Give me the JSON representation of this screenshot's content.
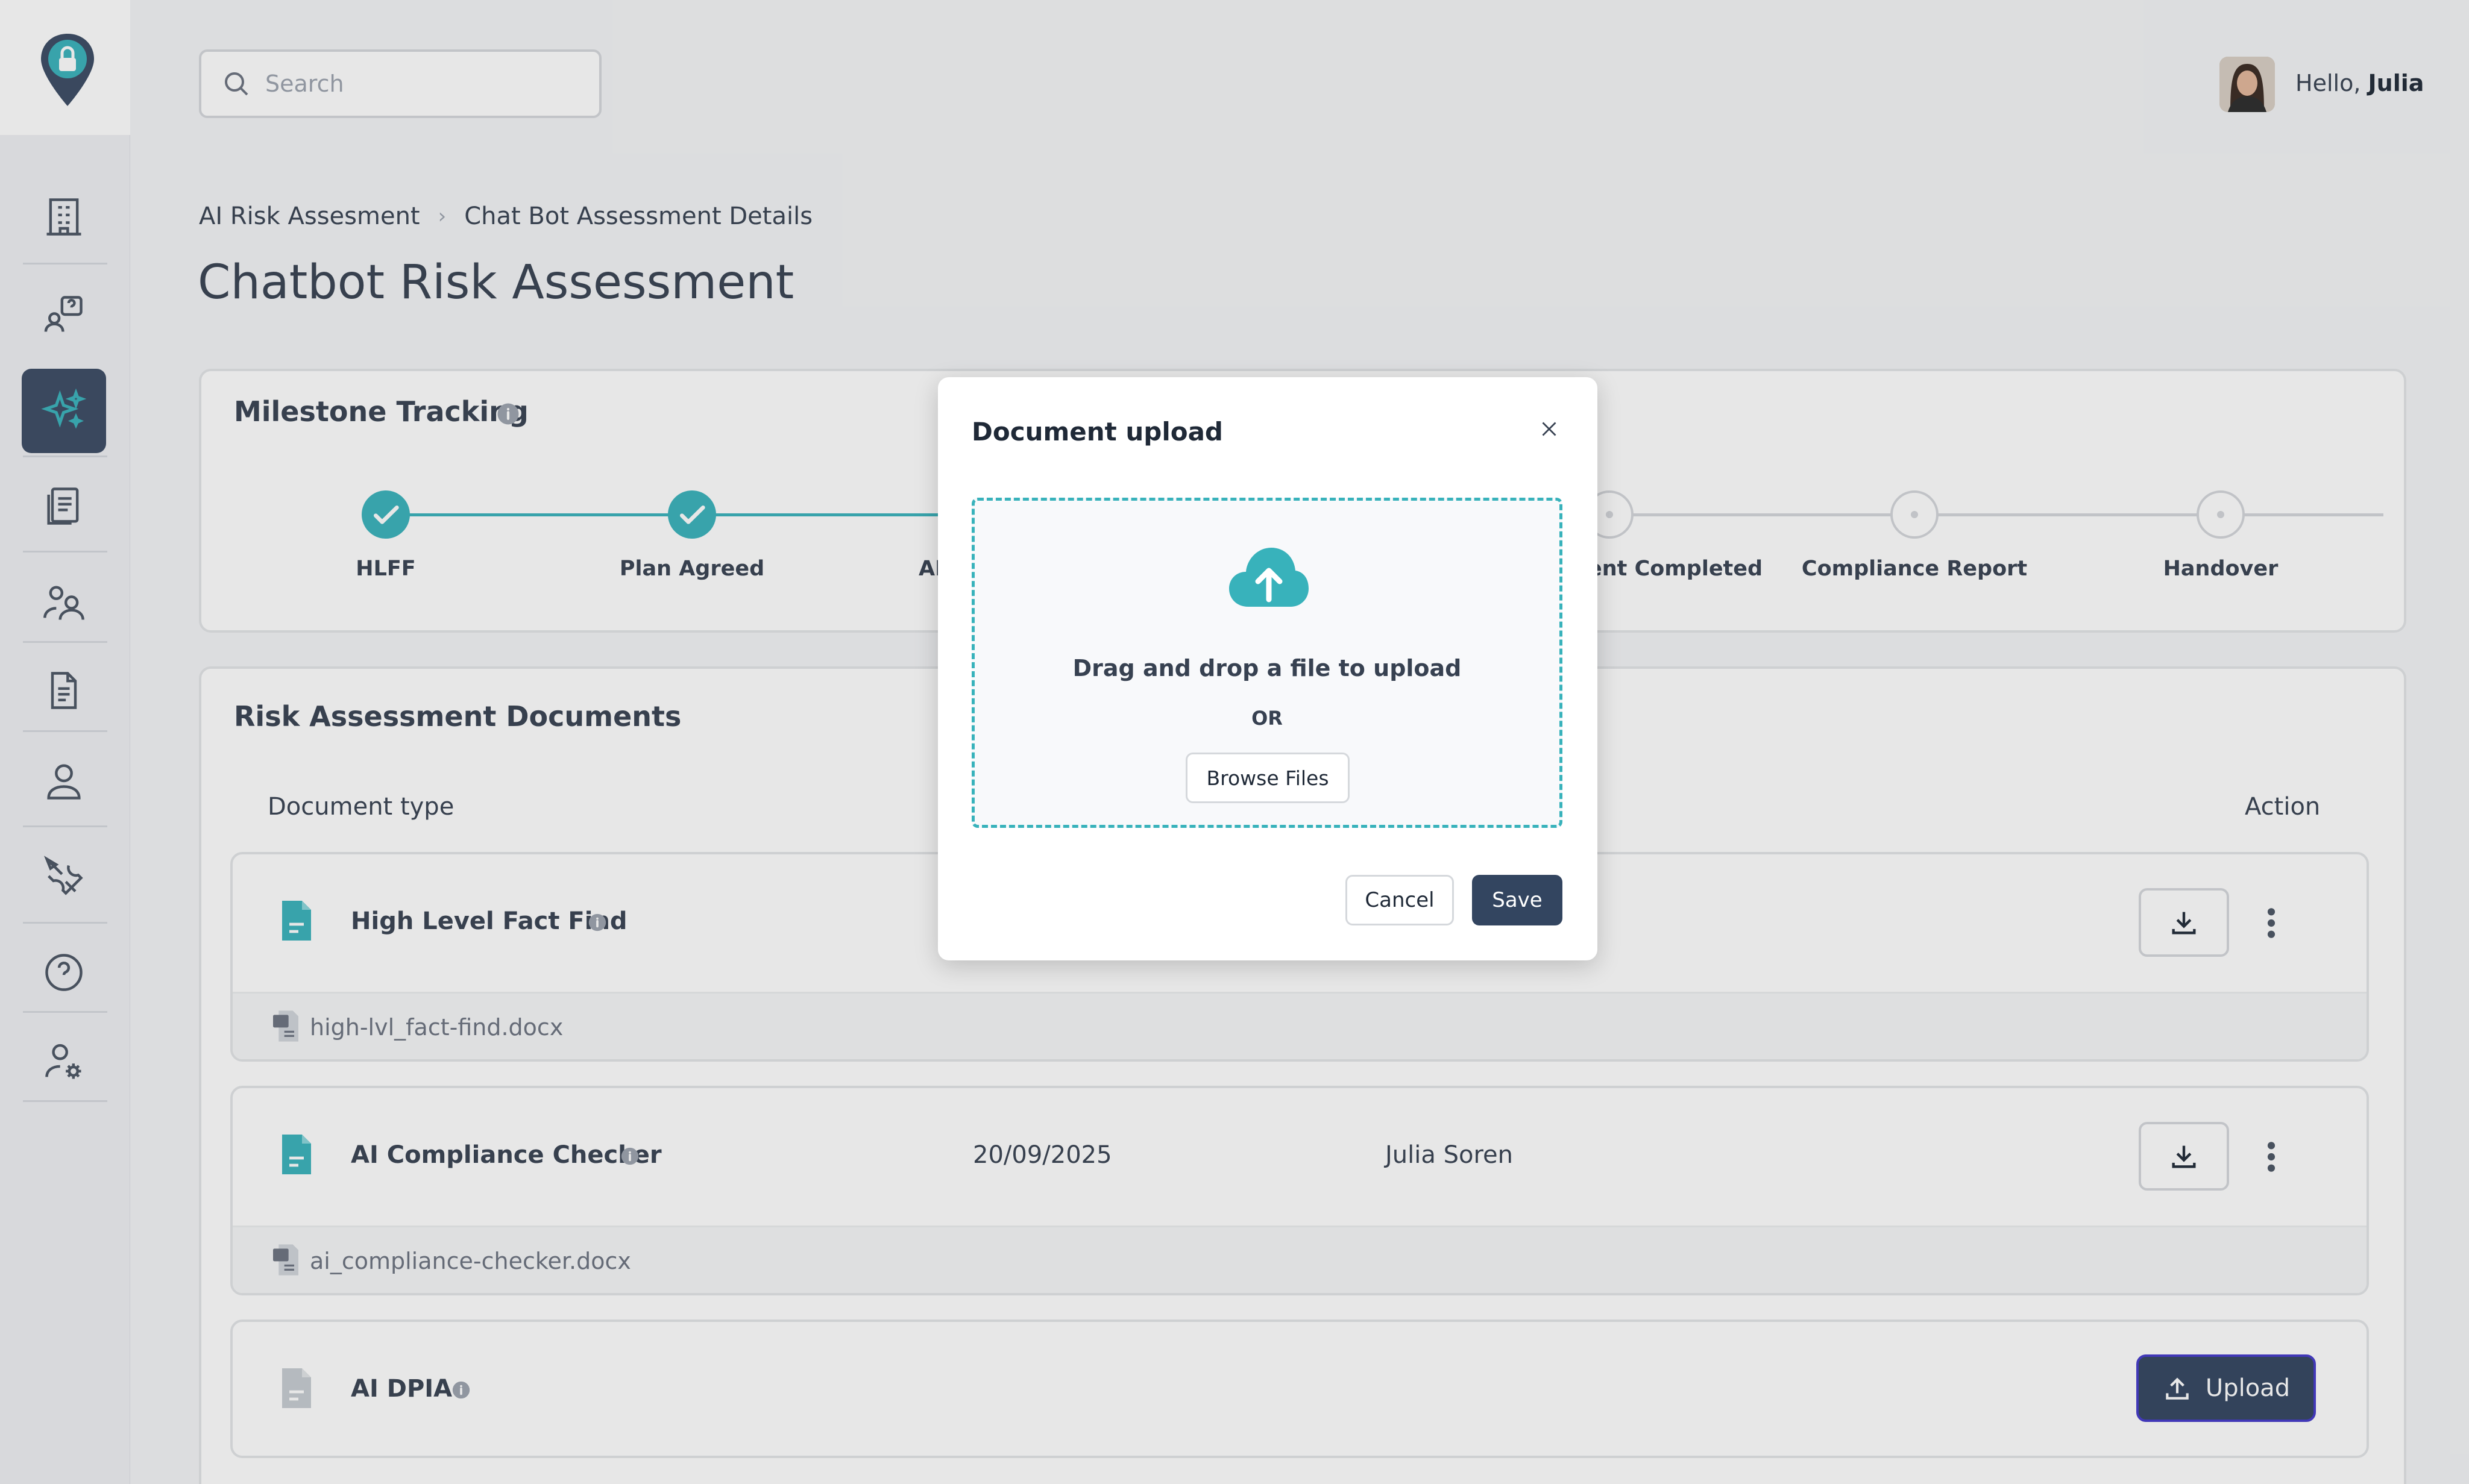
{
  "app": {
    "accent": "#38b2bb",
    "primary": "#334560"
  },
  "search": {
    "placeholder": "Search"
  },
  "user": {
    "greeting": "Hello,",
    "name": "Julia"
  },
  "breadcrumb": {
    "items": [
      "AI Risk Assesment",
      "Chat Bot Assessment Details"
    ],
    "separator": "›"
  },
  "page": {
    "title": "Chatbot Risk Assessment"
  },
  "milestones": {
    "title": "Milestone Tracking",
    "steps": [
      {
        "label": "HLFF",
        "status": "done"
      },
      {
        "label": "Plan Agreed",
        "status": "done"
      },
      {
        "label": "AI Co",
        "status": "hidden-by-modal"
      },
      {
        "label": "ent Completed",
        "status": "todo"
      },
      {
        "label": "Compliance Report",
        "status": "todo"
      },
      {
        "label": "Handover",
        "status": "todo"
      }
    ]
  },
  "documents": {
    "title": "Risk Assessment Documents",
    "columns": {
      "type": "Document type",
      "action": "Action"
    },
    "rows": [
      {
        "name": "High Level Fact Find",
        "file": "high-lvl_fact-find.docx",
        "date": "",
        "owner": ""
      },
      {
        "name": "AI Compliance Checker",
        "file": "ai_compliance-checker.docx",
        "date": "20/09/2025",
        "owner": "Julia Soren"
      },
      {
        "name": "AI DPIA",
        "action_label": "Upload"
      }
    ]
  },
  "modal": {
    "title": "Document upload",
    "drop_text": "Drag and drop a file to upload",
    "or_text": "OR",
    "browse_label": "Browse Files",
    "cancel_label": "Cancel",
    "save_label": "Save"
  }
}
